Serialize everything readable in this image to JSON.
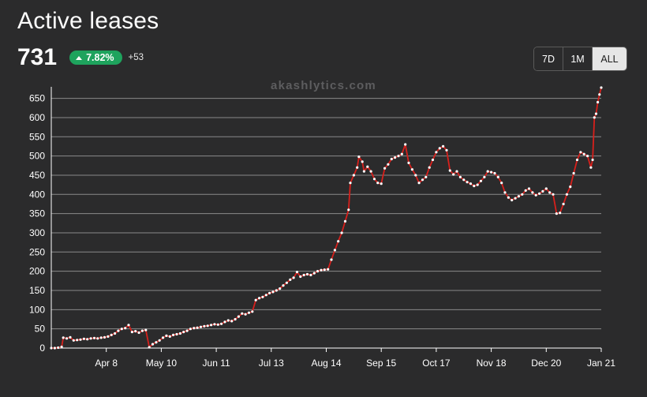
{
  "header": {
    "title": "Active leases",
    "count": "731",
    "change_percent": "7.82%",
    "change_abs": "+53"
  },
  "range_buttons": [
    "7D",
    "1M",
    "ALL"
  ],
  "active_range": "ALL",
  "watermark": "akashlytics.com",
  "colors": {
    "background": "#2b2b2c",
    "line": "#d7201c",
    "point": "#ffffff",
    "grid": "#8a8a8a",
    "badge": "#1ea35d"
  },
  "chart_data": {
    "type": "line",
    "title": "",
    "xlabel": "",
    "ylabel": "",
    "ylim": [
      0,
      680
    ],
    "yticks": [
      0,
      50,
      100,
      150,
      200,
      250,
      300,
      350,
      400,
      450,
      500,
      550,
      600,
      650
    ],
    "xtick_labels": [
      "Apr 8",
      "May 10",
      "Jun 11",
      "Jul 13",
      "Aug 14",
      "Sep 15",
      "Oct 17",
      "Nov 18",
      "Dec 20",
      "Jan 21"
    ],
    "grid": true,
    "x_start": "Mar 7",
    "x_end": "Jan 21",
    "points": [
      [
        "Mar 7",
        0
      ],
      [
        "Mar 9",
        0
      ],
      [
        "Mar 11",
        1
      ],
      [
        "Mar 13",
        3
      ],
      [
        "Mar 14",
        27
      ],
      [
        "Mar 16",
        25
      ],
      [
        "Mar 18",
        28
      ],
      [
        "Mar 20",
        20
      ],
      [
        "Mar 22",
        21
      ],
      [
        "Mar 24",
        22
      ],
      [
        "Mar 26",
        24
      ],
      [
        "Mar 28",
        23
      ],
      [
        "Mar 30",
        25
      ],
      [
        "Apr 1",
        26
      ],
      [
        "Apr 3",
        25
      ],
      [
        "Apr 5",
        27
      ],
      [
        "Apr 7",
        28
      ],
      [
        "Apr 9",
        30
      ],
      [
        "Apr 11",
        34
      ],
      [
        "Apr 13",
        38
      ],
      [
        "Apr 15",
        45
      ],
      [
        "Apr 17",
        50
      ],
      [
        "Apr 19",
        52
      ],
      [
        "Apr 21",
        60
      ],
      [
        "Apr 23",
        42
      ],
      [
        "Apr 25",
        44
      ],
      [
        "Apr 27",
        40
      ],
      [
        "Apr 29",
        45
      ],
      [
        "May 1",
        47
      ],
      [
        "May 3",
        2
      ],
      [
        "May 5",
        10
      ],
      [
        "May 7",
        15
      ],
      [
        "May 9",
        20
      ],
      [
        "May 11",
        27
      ],
      [
        "May 13",
        32
      ],
      [
        "May 15",
        30
      ],
      [
        "May 17",
        34
      ],
      [
        "May 19",
        36
      ],
      [
        "May 21",
        38
      ],
      [
        "May 23",
        42
      ],
      [
        "May 25",
        45
      ],
      [
        "May 27",
        50
      ],
      [
        "May 29",
        52
      ],
      [
        "May 31",
        53
      ],
      [
        "Jun 2",
        55
      ],
      [
        "Jun 4",
        57
      ],
      [
        "Jun 6",
        58
      ],
      [
        "Jun 8",
        60
      ],
      [
        "Jun 10",
        62
      ],
      [
        "Jun 12",
        61
      ],
      [
        "Jun 14",
        63
      ],
      [
        "Jun 16",
        68
      ],
      [
        "Jun 18",
        72
      ],
      [
        "Jun 20",
        70
      ],
      [
        "Jun 22",
        75
      ],
      [
        "Jun 24",
        82
      ],
      [
        "Jun 26",
        90
      ],
      [
        "Jun 28",
        88
      ],
      [
        "Jun 30",
        92
      ],
      [
        "Jul 2",
        95
      ],
      [
        "Jul 4",
        125
      ],
      [
        "Jul 6",
        130
      ],
      [
        "Jul 8",
        133
      ],
      [
        "Jul 10",
        138
      ],
      [
        "Jul 12",
        143
      ],
      [
        "Jul 14",
        146
      ],
      [
        "Jul 16",
        150
      ],
      [
        "Jul 18",
        155
      ],
      [
        "Jul 20",
        163
      ],
      [
        "Jul 22",
        170
      ],
      [
        "Jul 24",
        178
      ],
      [
        "Jul 26",
        183
      ],
      [
        "Jul 28",
        198
      ],
      [
        "Jul 30",
        186
      ],
      [
        "Aug 1",
        190
      ],
      [
        "Aug 3",
        192
      ],
      [
        "Aug 5",
        190
      ],
      [
        "Aug 7",
        195
      ],
      [
        "Aug 9",
        200
      ],
      [
        "Aug 11",
        203
      ],
      [
        "Aug 13",
        204
      ],
      [
        "Aug 15",
        205
      ],
      [
        "Aug 17",
        230
      ],
      [
        "Aug 19",
        255
      ],
      [
        "Aug 21",
        278
      ],
      [
        "Aug 23",
        300
      ],
      [
        "Aug 25",
        330
      ],
      [
        "Aug 27",
        360
      ],
      [
        "Aug 28",
        430
      ],
      [
        "Aug 30",
        450
      ],
      [
        "Sep 1",
        470
      ],
      [
        "Sep 2",
        498
      ],
      [
        "Sep 4",
        485
      ],
      [
        "Sep 5",
        460
      ],
      [
        "Sep 7",
        472
      ],
      [
        "Sep 9",
        460
      ],
      [
        "Sep 11",
        440
      ],
      [
        "Sep 13",
        430
      ],
      [
        "Sep 15",
        428
      ],
      [
        "Sep 17",
        468
      ],
      [
        "Sep 19",
        478
      ],
      [
        "Sep 21",
        492
      ],
      [
        "Sep 23",
        496
      ],
      [
        "Sep 25",
        500
      ],
      [
        "Sep 27",
        505
      ],
      [
        "Sep 29",
        530
      ],
      [
        "Oct 1",
        482
      ],
      [
        "Oct 3",
        465
      ],
      [
        "Oct 5",
        450
      ],
      [
        "Oct 7",
        430
      ],
      [
        "Oct 9",
        438
      ],
      [
        "Oct 11",
        445
      ],
      [
        "Oct 13",
        470
      ],
      [
        "Oct 15",
        490
      ],
      [
        "Oct 17",
        510
      ],
      [
        "Oct 19",
        520
      ],
      [
        "Oct 21",
        525
      ],
      [
        "Oct 23",
        515
      ],
      [
        "Oct 25",
        462
      ],
      [
        "Oct 27",
        452
      ],
      [
        "Oct 29",
        460
      ],
      [
        "Oct 31",
        445
      ],
      [
        "Nov 2",
        438
      ],
      [
        "Nov 4",
        432
      ],
      [
        "Nov 6",
        428
      ],
      [
        "Nov 8",
        422
      ],
      [
        "Nov 10",
        425
      ],
      [
        "Nov 12",
        435
      ],
      [
        "Nov 14",
        445
      ],
      [
        "Nov 16",
        460
      ],
      [
        "Nov 18",
        458
      ],
      [
        "Nov 20",
        455
      ],
      [
        "Nov 22",
        445
      ],
      [
        "Nov 24",
        430
      ],
      [
        "Nov 26",
        405
      ],
      [
        "Nov 28",
        392
      ],
      [
        "Nov 30",
        385
      ],
      [
        "Dec 2",
        390
      ],
      [
        "Dec 4",
        395
      ],
      [
        "Dec 6",
        400
      ],
      [
        "Dec 8",
        410
      ],
      [
        "Dec 10",
        415
      ],
      [
        "Dec 12",
        405
      ],
      [
        "Dec 14",
        398
      ],
      [
        "Dec 16",
        402
      ],
      [
        "Dec 18",
        408
      ],
      [
        "Dec 20",
        415
      ],
      [
        "Dec 22",
        405
      ],
      [
        "Dec 24",
        400
      ],
      [
        "Dec 26",
        350
      ],
      [
        "Dec 28",
        352
      ],
      [
        "Dec 30",
        375
      ],
      [
        "Jan 1",
        400
      ],
      [
        "Jan 3",
        420
      ],
      [
        "Jan 5",
        455
      ],
      [
        "Jan 7",
        490
      ],
      [
        "Jan 9",
        510
      ],
      [
        "Jan 11",
        505
      ],
      [
        "Jan 13",
        500
      ],
      [
        "Jan 15",
        470
      ],
      [
        "Jan 16",
        490
      ],
      [
        "Jan 17",
        600
      ],
      [
        "Jan 18",
        610
      ],
      [
        "Jan 19",
        640
      ],
      [
        "Jan 20",
        660
      ],
      [
        "Jan 21",
        678
      ]
    ]
  }
}
